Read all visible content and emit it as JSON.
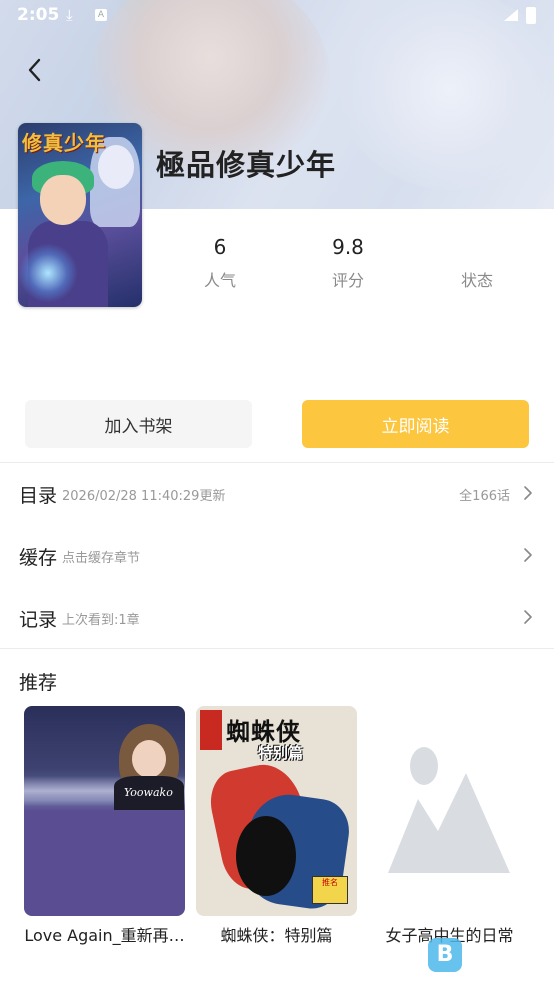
{
  "status_bar": {
    "time": "2:05",
    "download_icon": "download-icon",
    "notification_icon": "a-notification-icon"
  },
  "book": {
    "title": "極品修真少年",
    "cover_text": "修真少年"
  },
  "stats": [
    {
      "value": "6",
      "label": "人气"
    },
    {
      "value": "9.8",
      "label": "评分"
    },
    {
      "value": "",
      "label": "状态"
    }
  ],
  "actions": {
    "add_to_shelf": "加入书架",
    "read_now": "立即阅读"
  },
  "rows": {
    "catalog": {
      "title": "目录",
      "subtitle": "2026/02/28 11:40:29更新",
      "right": "全166话"
    },
    "cache": {
      "title": "缓存",
      "subtitle": "点击缓存章节"
    },
    "history": {
      "title": "记录",
      "subtitle": "上次看到:1章"
    }
  },
  "recommend": {
    "title": "推荐",
    "items": [
      {
        "label": "Love Again_重新再…",
        "cover_text": "Yoowako"
      },
      {
        "label": "蜘蛛侠：特别篇",
        "cover_title": "蜘蛛侠",
        "cover_sub": "特别篇",
        "cover_tag": "推名"
      },
      {
        "label": "女子高中生的日常"
      }
    ]
  },
  "colors": {
    "accent": "#fcc63f",
    "muted_text": "#999999"
  }
}
